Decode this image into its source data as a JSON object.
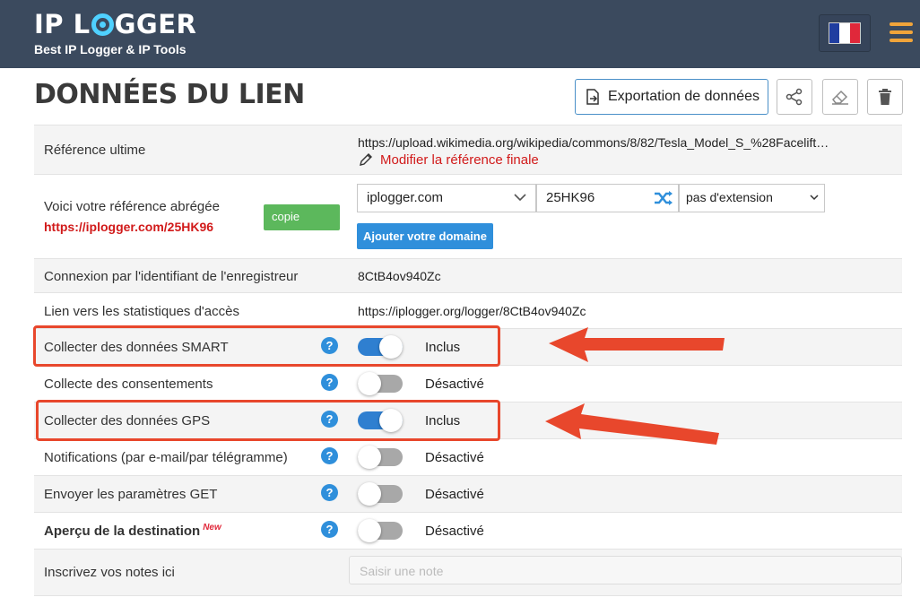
{
  "header": {
    "logo_left": "IP L",
    "logo_right": "GGER",
    "tagline": "Best IP Logger & IP Tools",
    "language_flag": "flag-france",
    "menu_icon": "hamburger-icon",
    "accent_color": "#f0a43a",
    "bg_color": "#3b4a5e"
  },
  "title_row": {
    "title": "DONNÉES DU LIEN",
    "export_label": "Exportation de données",
    "icons": [
      "export-icon",
      "share-icon",
      "eraser-icon",
      "trash-icon"
    ]
  },
  "rows": {
    "reference": {
      "label": "Référence ultime",
      "url": "https://upload.wikimedia.org/wikipedia/commons/8/82/Tesla_Model_S_%28Facelift…",
      "edit_link": "Modifier la référence finale"
    },
    "short_link": {
      "label": "Voici votre référence abrégée",
      "short_url": "https://iplogger.com/25HK96",
      "copy_label": "copie",
      "domain_value": "iplogger.com",
      "code_value": "25HK96",
      "extension_value": "pas d'extension",
      "add_domain_label": "Ajouter votre domaine"
    },
    "logger_id": {
      "label": "Connexion par l'identifiant de l'enregistreur",
      "value": "8CtB4ov940Zc"
    },
    "stats_link": {
      "label": "Lien vers les statistiques d'accès",
      "value": "https://iplogger.org/logger/8CtB4ov940Zc"
    },
    "toggles": [
      {
        "label": "Collecter des données SMART",
        "state": "Inclus",
        "on": true
      },
      {
        "label": "Collecte des consentements",
        "state": "Désactivé",
        "on": false
      },
      {
        "label": "Collecter des données GPS",
        "state": "Inclus",
        "on": true
      },
      {
        "label": "Notifications (par e-mail/par télégramme)",
        "state": "Désactivé",
        "on": false
      },
      {
        "label": "Envoyer les paramètres GET",
        "state": "Désactivé",
        "on": false
      },
      {
        "label": "Aperçu de la destination",
        "badge": "New",
        "state": "Désactivé",
        "on": false
      }
    ],
    "notes": {
      "label": "Inscrivez vos notes ici",
      "placeholder": "Saisir une note"
    }
  },
  "help_glyph": "?",
  "annotation_color": "#e8472c"
}
